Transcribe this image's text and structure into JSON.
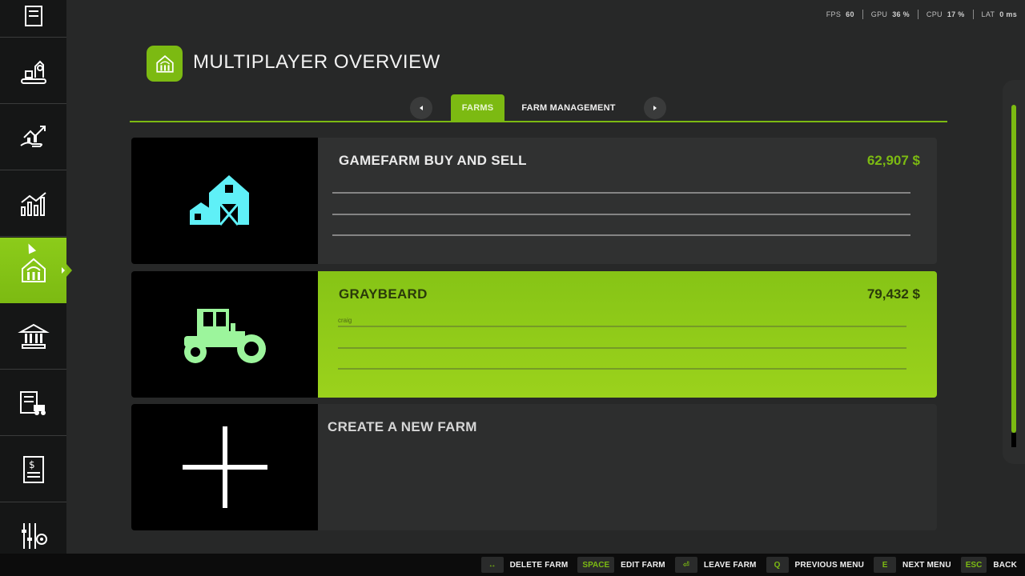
{
  "perf": [
    {
      "label": "FPS",
      "value": "60"
    },
    {
      "label": "GPU",
      "value": "36 %"
    },
    {
      "label": "CPU",
      "value": "17 %"
    },
    {
      "label": "LAT",
      "value": "0 ms"
    }
  ],
  "header": {
    "title": "MULTIPLAYER OVERVIEW"
  },
  "tabs": [
    {
      "label": "FARMS",
      "active": true
    },
    {
      "label": "FARM MANAGEMENT",
      "active": false
    }
  ],
  "sidebar": {
    "items": [
      {
        "icon": "contracts-icon"
      },
      {
        "icon": "production-icon"
      },
      {
        "icon": "finances-icon"
      },
      {
        "icon": "statistics-icon"
      },
      {
        "icon": "farm-icon",
        "active": true
      },
      {
        "icon": "bank-icon"
      },
      {
        "icon": "vehicles-icon"
      },
      {
        "icon": "price-list-icon"
      },
      {
        "icon": "settings-icon"
      }
    ]
  },
  "farms": [
    {
      "name": "GAMEFARM BUY AND SELL",
      "money": "62,907 $",
      "icon": "barn-icon",
      "color": "#5ff0f7",
      "member": ""
    },
    {
      "name": "GRAYBEARD",
      "money": "79,432 $",
      "icon": "tractor-icon",
      "color": "#9cf59c",
      "member": "craig"
    }
  ],
  "create_farm": {
    "label": "CREATE A NEW FARM",
    "icon": "plus-icon"
  },
  "footer": [
    {
      "key": "↔",
      "label": "DELETE FARM"
    },
    {
      "key": "SPACE",
      "label": "EDIT FARM"
    },
    {
      "key": "⏎",
      "label": "LEAVE FARM"
    },
    {
      "key": "Q",
      "label": "PREVIOUS MENU"
    },
    {
      "key": "E",
      "label": "NEXT MENU"
    },
    {
      "key": "ESC",
      "label": "BACK"
    }
  ],
  "colors": {
    "accent": "#7cba12",
    "background": "#272828",
    "sidebar": "#151616"
  }
}
